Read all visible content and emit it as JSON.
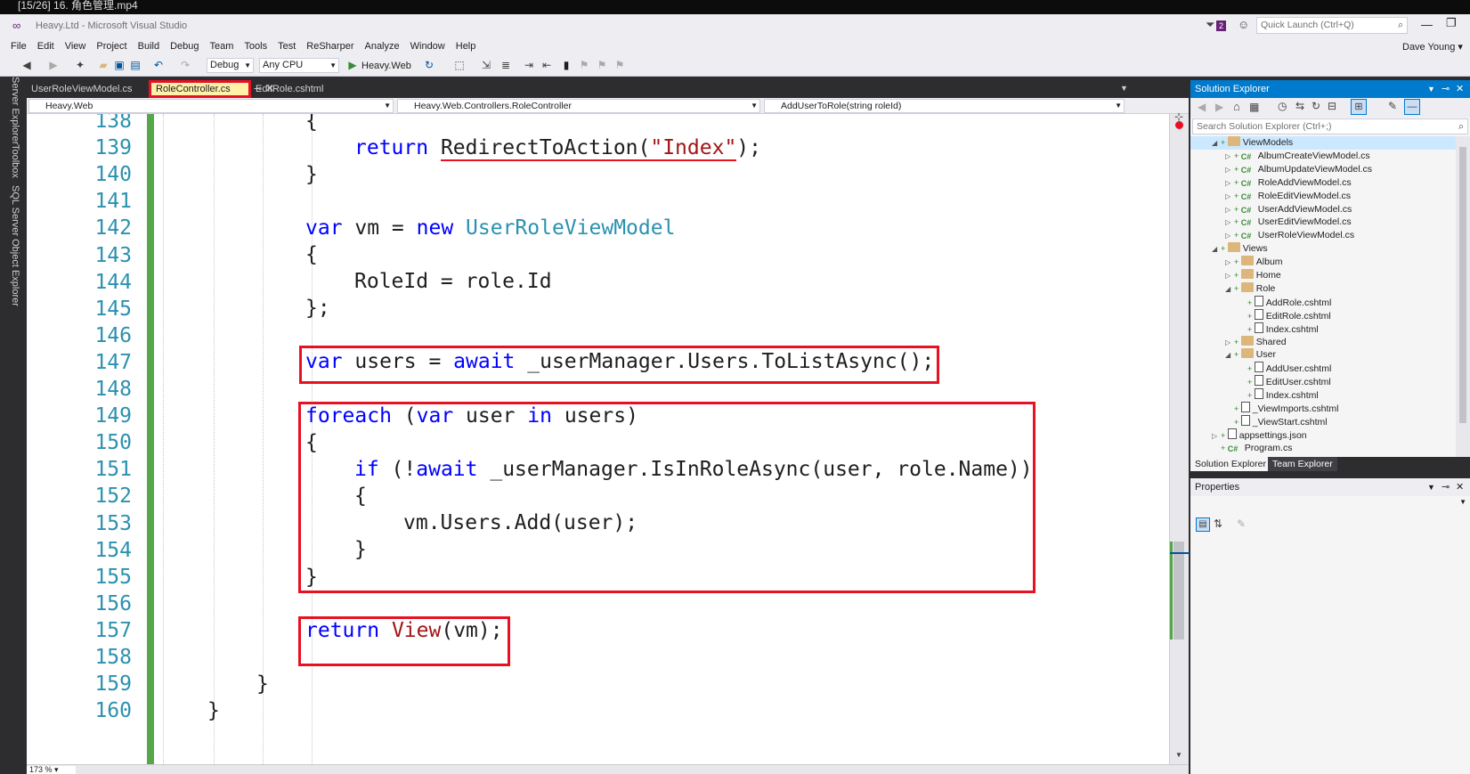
{
  "player": {
    "title": "[15/26] 16. 角色管理.mp4"
  },
  "window": {
    "title": "Heavy.Ltd - Microsoft Visual Studio",
    "notif_count": "2",
    "quick_launch_placeholder": "Quick Launch (Ctrl+Q)",
    "user": "Dave Young"
  },
  "menu": [
    "File",
    "Edit",
    "View",
    "Project",
    "Build",
    "Debug",
    "Team",
    "Tools",
    "Test",
    "ReSharper",
    "Analyze",
    "Window",
    "Help"
  ],
  "toolbar": {
    "config": "Debug",
    "platform": "Any CPU",
    "run_target": "Heavy.Web"
  },
  "left_tabs": [
    "Server Explorer",
    "Toolbox",
    "SQL Server Object Explorer"
  ],
  "doc_tabs": [
    {
      "label": "UserRoleViewModel.cs",
      "active": false
    },
    {
      "label": "RoleController.cs",
      "active": true
    },
    {
      "label": "EditRole.cshtml",
      "active": false
    }
  ],
  "navbar": {
    "project": "Heavy.Web",
    "class": "Heavy.Web.Controllers.RoleController",
    "member": "AddUserToRole(string roleId)"
  },
  "editor": {
    "line_numbers": [
      "138",
      "139",
      "140",
      "141",
      "142",
      "143",
      "144",
      "145",
      "146",
      "147",
      "148",
      "149",
      "150",
      "151",
      "152",
      "153",
      "154",
      "155",
      "156",
      "157",
      "158",
      "159",
      "160"
    ],
    "zoom": "173 %"
  },
  "solution_explorer": {
    "title": "Solution Explorer",
    "search_placeholder": "Search Solution Explorer (Ctrl+;)",
    "nodes": [
      {
        "label": "ViewModels",
        "type": "folder",
        "indent": 2,
        "expanded": true
      },
      {
        "label": "AlbumCreateViewModel.cs",
        "type": "cs",
        "indent": 3
      },
      {
        "label": "AlbumUpdateViewModel.cs",
        "type": "cs",
        "indent": 3
      },
      {
        "label": "RoleAddViewModel.cs",
        "type": "cs",
        "indent": 3
      },
      {
        "label": "RoleEditViewModel.cs",
        "type": "cs",
        "indent": 3
      },
      {
        "label": "UserAddViewModel.cs",
        "type": "cs",
        "indent": 3
      },
      {
        "label": "UserEditViewModel.cs",
        "type": "cs",
        "indent": 3
      },
      {
        "label": "UserRoleViewModel.cs",
        "type": "cs",
        "indent": 3
      },
      {
        "label": "Views",
        "type": "folder",
        "indent": 2,
        "expanded": true
      },
      {
        "label": "Album",
        "type": "folder",
        "indent": 3
      },
      {
        "label": "Home",
        "type": "folder",
        "indent": 3
      },
      {
        "label": "Role",
        "type": "folder",
        "indent": 3,
        "expanded": true
      },
      {
        "label": "AddRole.cshtml",
        "type": "page",
        "indent": 4
      },
      {
        "label": "EditRole.cshtml",
        "type": "page",
        "indent": 4
      },
      {
        "label": "Index.cshtml",
        "type": "page",
        "indent": 4
      },
      {
        "label": "Shared",
        "type": "folder",
        "indent": 3
      },
      {
        "label": "User",
        "type": "folder",
        "indent": 3,
        "expanded": true
      },
      {
        "label": "AddUser.cshtml",
        "type": "page",
        "indent": 4
      },
      {
        "label": "EditUser.cshtml",
        "type": "page",
        "indent": 4
      },
      {
        "label": "Index.cshtml",
        "type": "page",
        "indent": 4
      },
      {
        "label": "_ViewImports.cshtml",
        "type": "page",
        "indent": 3
      },
      {
        "label": "_ViewStart.cshtml",
        "type": "page",
        "indent": 3
      },
      {
        "label": "appsettings.json",
        "type": "json",
        "indent": 2
      },
      {
        "label": "Program.cs",
        "type": "cs",
        "indent": 2
      }
    ],
    "tabs": [
      "Solution Explorer",
      "Team Explorer"
    ]
  },
  "properties": {
    "title": "Properties"
  }
}
